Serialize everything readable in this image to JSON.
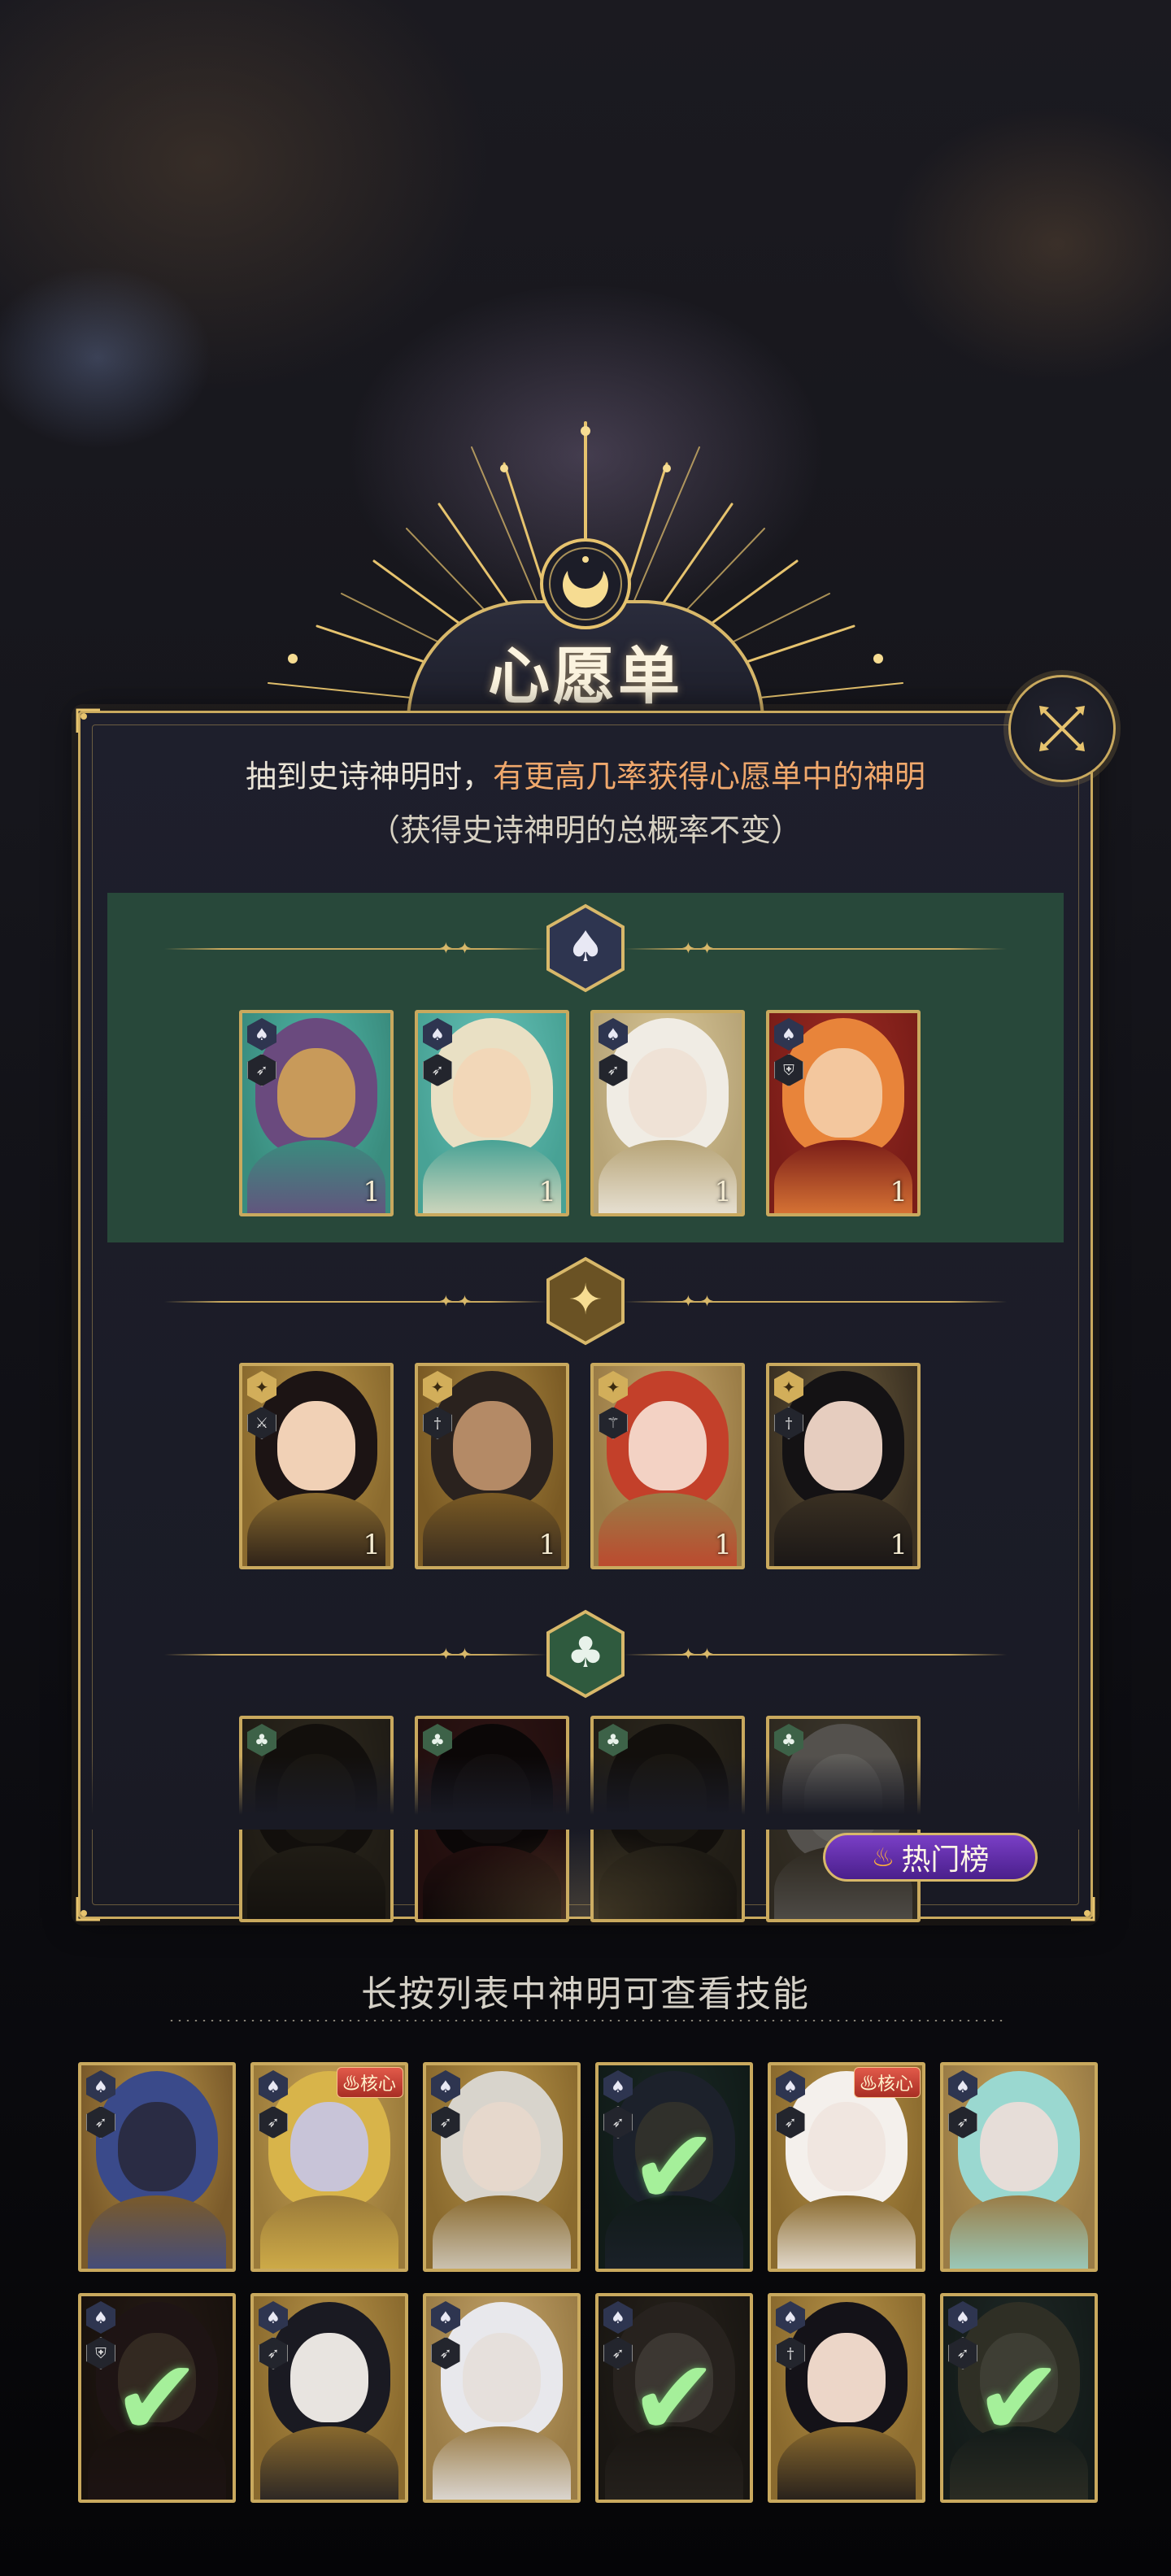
{
  "dialog": {
    "title": "心愿单",
    "subtitle_plain": "抽到史诗神明时，",
    "subtitle_highlight": "有更高几率获得心愿单中的神明",
    "note": "（获得史诗神明的总概率不变）",
    "hot_button_label": "热门榜",
    "close_icon": "close-x-icon"
  },
  "tiers": [
    {
      "badge_icon": "spade-icon",
      "selected": true,
      "cards": [
        {
          "level": "1",
          "class_icon": "spade-icon",
          "role_icon": "bow-icon",
          "palette": [
            "#4fb6a7",
            "#3a8c7e",
            "#c89a5a",
            "#6a4a7e"
          ]
        },
        {
          "level": "1",
          "class_icon": "spade-icon",
          "role_icon": "bow-icon",
          "palette": [
            "#66c2b8",
            "#48a295",
            "#f2d7b8",
            "#e9e0c4"
          ]
        },
        {
          "level": "1",
          "class_icon": "spade-icon",
          "role_icon": "bow-icon",
          "palette": [
            "#d9c89a",
            "#b7a477",
            "#efe2d6",
            "#f0ece4"
          ]
        },
        {
          "level": "1",
          "class_icon": "spade-icon",
          "role_icon": "shield-icon",
          "palette": [
            "#9a2a22",
            "#7a1d18",
            "#f3c79e",
            "#e8843a"
          ]
        }
      ]
    },
    {
      "badge_icon": "sparkle-icon",
      "selected": false,
      "cards": [
        {
          "level": "1",
          "class_icon": "sparkle-icon",
          "role_icon": "sword-icon",
          "palette": [
            "#b89448",
            "#8a6a2e",
            "#f1d1b6",
            "#1c1414"
          ]
        },
        {
          "level": "1",
          "class_icon": "sparkle-icon",
          "role_icon": "dagger-icon",
          "palette": [
            "#a8853e",
            "#7a5a24",
            "#b48a66",
            "#2a221e"
          ]
        },
        {
          "level": "1",
          "class_icon": "sparkle-icon",
          "role_icon": "staff-icon",
          "palette": [
            "#c4a46a",
            "#9a7c46",
            "#f3d2c4",
            "#c3402a"
          ]
        },
        {
          "level": "1",
          "class_icon": "sparkle-icon",
          "role_icon": "dagger-icon",
          "palette": [
            "#6a5a3a",
            "#3a3022",
            "#e6cdbf",
            "#141214"
          ]
        }
      ]
    },
    {
      "badge_icon": "club-icon",
      "selected": false,
      "cards": [
        {
          "level": "",
          "class_icon": "club-icon",
          "role_icon": "",
          "palette": [
            "#6a5a3a",
            "#4a3e28",
            "#3a3022",
            "#2a2218"
          ]
        },
        {
          "level": "",
          "class_icon": "club-icon",
          "role_icon": "",
          "palette": [
            "#7a2a28",
            "#5a1c1a",
            "#2a1c1c",
            "#1a1010"
          ]
        },
        {
          "level": "",
          "class_icon": "club-icon",
          "role_icon": "",
          "palette": [
            "#6a5a3a",
            "#4a3e28",
            "#3a3022",
            "#2a2218"
          ]
        },
        {
          "level": "",
          "class_icon": "club-icon",
          "role_icon": "",
          "palette": [
            "#8a7a5a",
            "#6a5a3e",
            "#d8d0c4",
            "#bcb4a8"
          ]
        }
      ]
    }
  ],
  "roster": {
    "hint": "长按列表中神明可查看技能",
    "rows": [
      [
        {
          "class_icon": "spade-icon",
          "role_icon": "bow-icon",
          "core_tag": "",
          "checked": false,
          "palette": [
            "#b89448",
            "#7a5a2a",
            "#2a2c44",
            "#3a4a8a"
          ]
        },
        {
          "class_icon": "spade-icon",
          "role_icon": "bow-icon",
          "core_tag": "核心",
          "checked": false,
          "palette": [
            "#c8a458",
            "#9a7a3a",
            "#c8c4d8",
            "#d8b44a"
          ]
        },
        {
          "class_icon": "spade-icon",
          "role_icon": "bow-icon",
          "core_tag": "",
          "checked": false,
          "palette": [
            "#b89448",
            "#8a6a2e",
            "#e6d8cc",
            "#d8d4cc"
          ]
        },
        {
          "class_icon": "spade-icon",
          "role_icon": "bow-icon",
          "core_tag": "",
          "checked": true,
          "palette": [
            "#2e5a4e",
            "#1e3e36",
            "#6a6a5a",
            "#3a4a6a"
          ]
        },
        {
          "class_icon": "spade-icon",
          "role_icon": "bow-icon",
          "core_tag": "核心",
          "checked": false,
          "palette": [
            "#b89448",
            "#8a6a2e",
            "#f0e6e0",
            "#f4f0ec"
          ]
        },
        {
          "class_icon": "spade-icon",
          "role_icon": "bow-icon",
          "core_tag": "",
          "checked": false,
          "palette": [
            "#c8a458",
            "#9a7c46",
            "#e6ddd8",
            "#9ad8d0"
          ]
        }
      ],
      [
        {
          "class_icon": "spade-icon",
          "role_icon": "shield-icon",
          "core_tag": "",
          "checked": true,
          "palette": [
            "#5a3a26",
            "#3a2418",
            "#7a5a40",
            "#4a2a2a"
          ]
        },
        {
          "class_icon": "spade-icon",
          "role_icon": "bow-icon",
          "core_tag": "",
          "checked": false,
          "palette": [
            "#b89448",
            "#8a6a2e",
            "#e8e4e0",
            "#1a1a22"
          ]
        },
        {
          "class_icon": "spade-icon",
          "role_icon": "bow-icon",
          "core_tag": "",
          "checked": false,
          "palette": [
            "#c4a46a",
            "#9a7c46",
            "#e6e0dc",
            "#e8e8ec"
          ]
        },
        {
          "class_icon": "spade-icon",
          "role_icon": "bow-icon",
          "core_tag": "",
          "checked": true,
          "palette": [
            "#5a4a34",
            "#3a3024",
            "#8a7a6a",
            "#5a4c3e"
          ]
        },
        {
          "class_icon": "spade-icon",
          "role_icon": "dagger-icon",
          "core_tag": "",
          "checked": false,
          "palette": [
            "#b89448",
            "#8a6a2e",
            "#ecd6c8",
            "#141218"
          ]
        },
        {
          "class_icon": "spade-icon",
          "role_icon": "bow-icon",
          "core_tag": "",
          "checked": true,
          "palette": [
            "#3a5a52",
            "#263e38",
            "#8a8a6a",
            "#6a6a4a"
          ]
        }
      ]
    ]
  }
}
